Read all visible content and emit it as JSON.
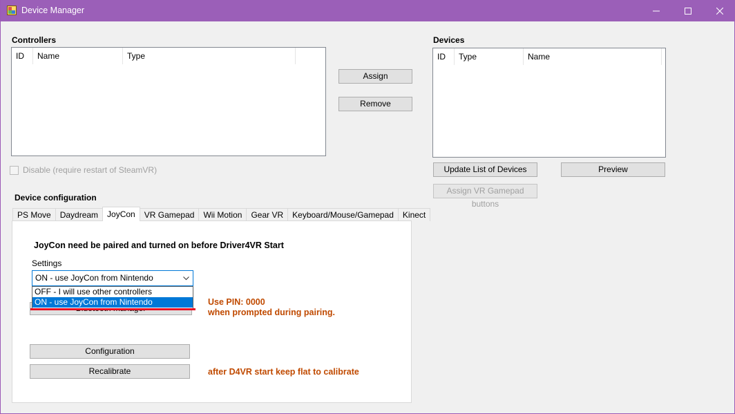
{
  "window": {
    "title": "Device Manager"
  },
  "controllers": {
    "label": "Controllers",
    "columns": [
      "ID",
      "Name",
      "Type"
    ]
  },
  "actions": {
    "assign": "Assign",
    "remove": "Remove"
  },
  "devices": {
    "label": "Devices",
    "columns": [
      "ID",
      "Type",
      "Name"
    ],
    "update_button": "Update List of Devices",
    "preview_button": "Preview",
    "assign_vr_gamepad": "Assign VR Gamepad buttons"
  },
  "disable_checkbox": {
    "label": "Disable (require restart of SteamVR)",
    "checked": false
  },
  "device_config": {
    "label": "Device configuration",
    "tabs": [
      "PS Move",
      "Daydream",
      "JoyCon",
      "VR Gamepad",
      "Wii Motion",
      "Gear VR",
      "Keyboard/Mouse/Gamepad",
      "Kinect"
    ],
    "active_tab": "JoyCon"
  },
  "joycon": {
    "heading": "JoyCon need be paired and turned on before Driver4VR Start",
    "settings_label": "Settings",
    "combo_value": "ON - use JoyCon from Nintendo",
    "options": [
      "OFF - I will use other controllers",
      "ON - use JoyCon from Nintendo"
    ],
    "selected_option": "ON - use JoyCon from Nintendo",
    "bluetooth_button": "Bluetooth manager",
    "pin_line1": "Use PIN: 0000",
    "pin_line2": "when prompted during pairing.",
    "configuration_button": "Configuration",
    "recalibrate_button": "Recalibrate",
    "calibrate_hint": "after D4VR start keep flat to calibrate"
  },
  "colors": {
    "titlebar": "#9b5fb8",
    "accent_blue": "#0078d7",
    "hint_orange": "#c04a00",
    "underline_red": "#e81123"
  }
}
